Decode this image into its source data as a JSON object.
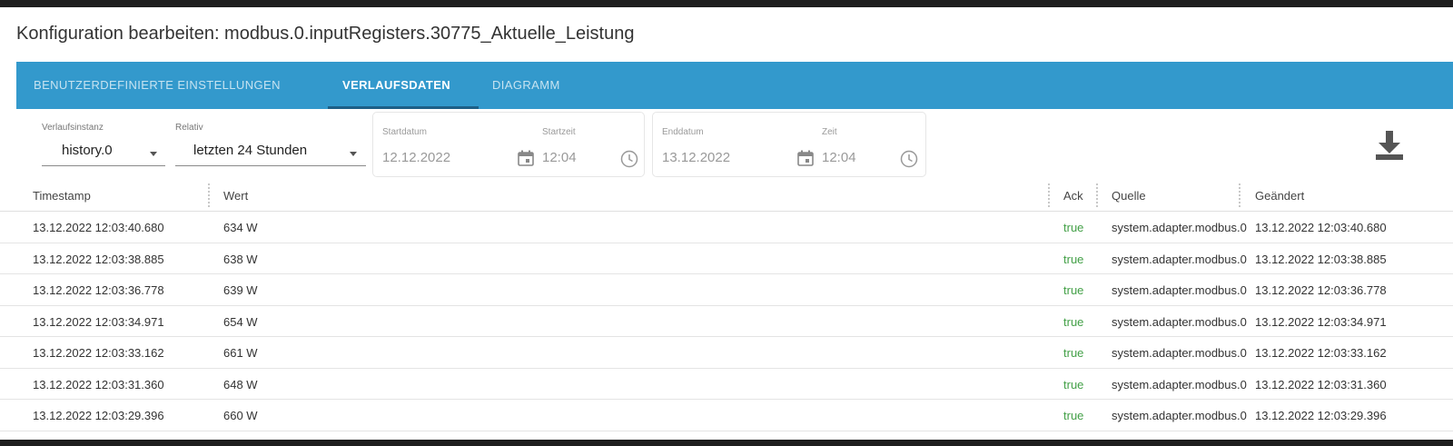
{
  "dialog": {
    "title": "Konfiguration bearbeiten: modbus.0.inputRegisters.30775_Aktuelle_Leistung"
  },
  "tabs": [
    {
      "label": "BENUTZERDEFINIERTE EINSTELLUNGEN",
      "active": false
    },
    {
      "label": "VERLAUFSDATEN",
      "active": true
    },
    {
      "label": "DIAGRAMM",
      "active": false
    }
  ],
  "filters": {
    "instance": {
      "label": "Verlaufsinstanz",
      "value": "history.0"
    },
    "relative": {
      "label": "Relativ",
      "value": "letzten 24 Stunden"
    },
    "start_date": {
      "label": "Startdatum",
      "value": "12.12.2022"
    },
    "start_time": {
      "label": "Startzeit",
      "value": "12:04"
    },
    "end_date": {
      "label": "Enddatum",
      "value": "13.12.2022"
    },
    "end_time": {
      "label": "Zeit",
      "value": "12:04"
    }
  },
  "table": {
    "columns": [
      "Timestamp",
      "Wert",
      "Ack",
      "Quelle",
      "Geändert"
    ],
    "rows": [
      {
        "timestamp": "13.12.2022 12:03:40.680",
        "value": "634 W",
        "ack": "true",
        "source": "system.adapter.modbus.0",
        "changed": "13.12.2022 12:03:40.680"
      },
      {
        "timestamp": "13.12.2022 12:03:38.885",
        "value": "638 W",
        "ack": "true",
        "source": "system.adapter.modbus.0",
        "changed": "13.12.2022 12:03:38.885"
      },
      {
        "timestamp": "13.12.2022 12:03:36.778",
        "value": "639 W",
        "ack": "true",
        "source": "system.adapter.modbus.0",
        "changed": "13.12.2022 12:03:36.778"
      },
      {
        "timestamp": "13.12.2022 12:03:34.971",
        "value": "654 W",
        "ack": "true",
        "source": "system.adapter.modbus.0",
        "changed": "13.12.2022 12:03:34.971"
      },
      {
        "timestamp": "13.12.2022 12:03:33.162",
        "value": "661 W",
        "ack": "true",
        "source": "system.adapter.modbus.0",
        "changed": "13.12.2022 12:03:33.162"
      },
      {
        "timestamp": "13.12.2022 12:03:31.360",
        "value": "648 W",
        "ack": "true",
        "source": "system.adapter.modbus.0",
        "changed": "13.12.2022 12:03:31.360"
      },
      {
        "timestamp": "13.12.2022 12:03:29.396",
        "value": "660 W",
        "ack": "true",
        "source": "system.adapter.modbus.0",
        "changed": "13.12.2022 12:03:29.396"
      }
    ]
  },
  "icons": {
    "download": "download-icon",
    "calendar": "calendar-icon",
    "clock": "clock-icon"
  },
  "colors": {
    "tab_bar": "#3399cc",
    "ack_true": "#43a047"
  }
}
